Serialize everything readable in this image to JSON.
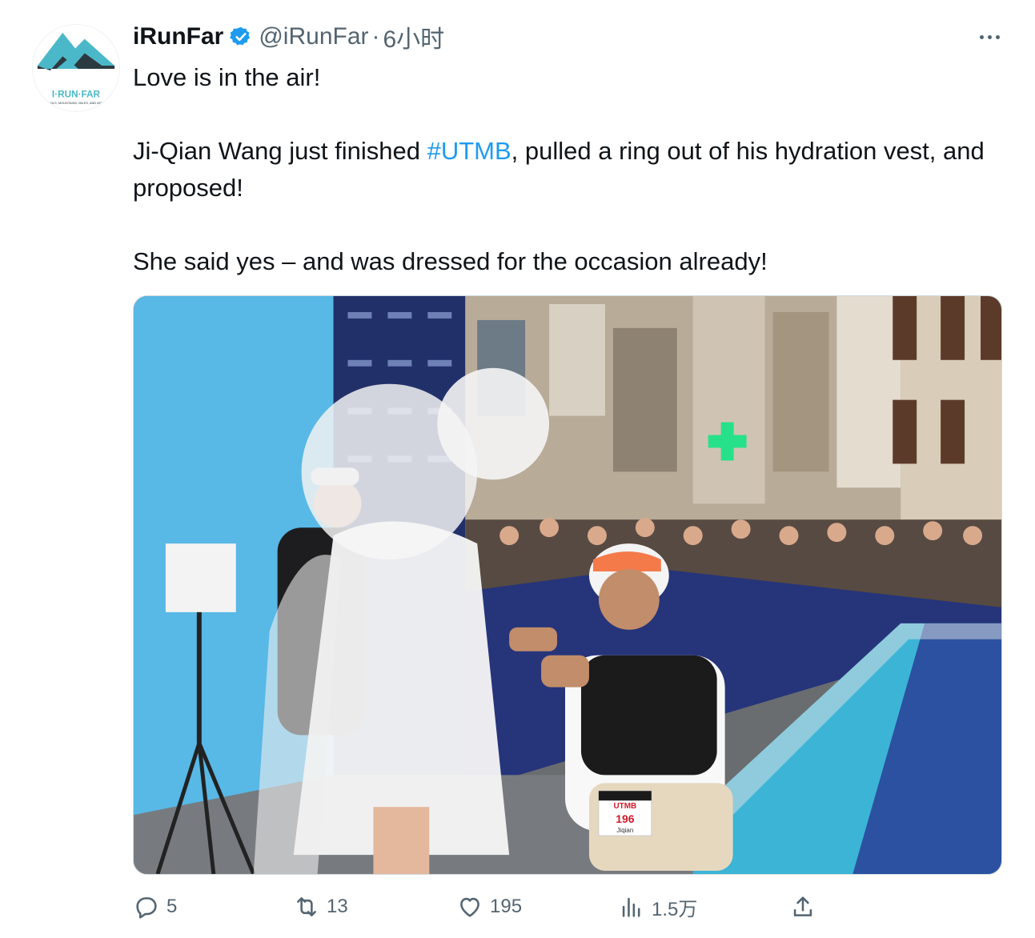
{
  "tweet": {
    "author_name": "iRunFar",
    "author_handle": "@iRunFar",
    "separator": "·",
    "time": "6小时",
    "text_line1": "Love is in the air!",
    "text_p2_before": "Ji-Qian Wang just finished ",
    "hashtag": "#UTMB",
    "text_p2_after": ", pulled a ring out of his hydration vest, and proposed!",
    "text_p3": "She said yes – and was dressed for the occasion already!"
  },
  "avatar": {
    "logo_text": "I·RUN·FAR",
    "tagline": "TRAILS, MOUNTAINS, MILES, AND MORE"
  },
  "media": {
    "bib_brand": "UTMB",
    "bib_number": "196",
    "bib_name": "Jiqian"
  },
  "actions": {
    "replies": "5",
    "retweets": "13",
    "likes": "195",
    "views": "1.5万"
  },
  "colors": {
    "link": "#1d9bf0",
    "muted": "#536471",
    "verified": "#1d9bf0",
    "logo_teal": "#4bb8c9"
  },
  "icons": [
    "verified-badge-icon",
    "more-icon",
    "reply-icon",
    "retweet-icon",
    "like-icon",
    "views-icon",
    "share-icon"
  ]
}
